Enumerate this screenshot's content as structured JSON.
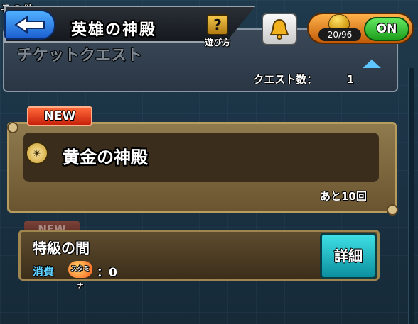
{
  "header": {
    "back_label": "",
    "title": "英雄の神殿",
    "help_label": "遊び方",
    "help_icon": "question-mark-icon",
    "stamina_count": "20/96",
    "toggle_label": "ON"
  },
  "top_panel": {
    "cut_text": "その他",
    "ghost_text": "チケットクエスト",
    "quest_count_label": "クエスト数：",
    "quest_count_value": "1"
  },
  "temple_card": {
    "badge": "NEW",
    "title": "黄金の神殿",
    "remaining": "あと10回"
  },
  "special_card": {
    "badge": "NEW",
    "title": "特級の間",
    "cost_label": "消費",
    "stamina_icon_text": "スタミナ",
    "cost_value": "：0",
    "detail_label": "詳細"
  },
  "colors": {
    "accent_blue": "#5ec7ff",
    "on_green": "#1d9e1c",
    "badge_red": "#c6200a",
    "detail_cyan": "#0b8f9e"
  }
}
